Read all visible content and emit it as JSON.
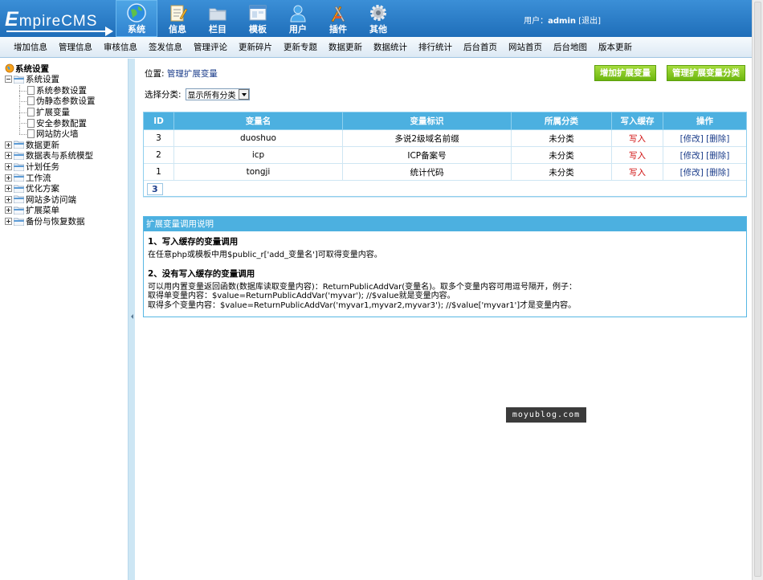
{
  "logo": {
    "first": "E",
    "rest": "mpireCMS"
  },
  "topnav": [
    {
      "label": "系统",
      "icon": "globe-icon",
      "active": true
    },
    {
      "label": "信息",
      "icon": "notepad-icon"
    },
    {
      "label": "栏目",
      "icon": "folder-icon"
    },
    {
      "label": "模板",
      "icon": "window-icon"
    },
    {
      "label": "用户",
      "icon": "user-icon"
    },
    {
      "label": "插件",
      "icon": "tools-icon"
    },
    {
      "label": "其他",
      "icon": "gear-icon"
    }
  ],
  "user": {
    "prefix": "用户：",
    "name": "admin",
    "logout": "[退出]"
  },
  "subnav": [
    "增加信息",
    "管理信息",
    "审核信息",
    "签发信息",
    "管理评论",
    "更新碎片",
    "更新专题",
    "数据更新",
    "数据统计",
    "排行统计",
    "后台首页",
    "网站首页",
    "后台地图",
    "版本更新"
  ],
  "tree": {
    "root": "系统设置",
    "open_folder": "系统设置",
    "children": [
      "系统参数设置",
      "伪静态参数设置",
      "扩展变量",
      "安全参数配置",
      "网站防火墙"
    ],
    "folders": [
      "数据更新",
      "数据表与系统模型",
      "计划任务",
      "工作流",
      "优化方案",
      "网站多访问端",
      "扩展菜单",
      "备份与恢复数据"
    ]
  },
  "breadcrumb": {
    "prefix": "位置: ",
    "link": "管理扩展变量"
  },
  "buttons": {
    "add": "增加扩展变量",
    "manage_class": "管理扩展变量分类"
  },
  "filter": {
    "label": "选择分类:",
    "selected": "显示所有分类"
  },
  "table": {
    "headers": [
      "ID",
      "变量名",
      "变量标识",
      "所属分类",
      "写入缓存",
      "操作"
    ],
    "rows": [
      {
        "id": "3",
        "name": "duoshuo",
        "tag": "多说2级域名前缀",
        "category": "未分类",
        "cache": "写入",
        "edit": "[修改]",
        "del": "[删除]"
      },
      {
        "id": "2",
        "name": "icp",
        "tag": "ICP备案号",
        "category": "未分类",
        "cache": "写入",
        "edit": "[修改]",
        "del": "[删除]"
      },
      {
        "id": "1",
        "name": "tongji",
        "tag": "统计代码",
        "category": "未分类",
        "cache": "写入",
        "edit": "[修改]",
        "del": "[删除]"
      }
    ],
    "pager": "3"
  },
  "help": {
    "title": "扩展变量调用说明",
    "h1": "1、写入缓存的变量调用",
    "p1": "在任意php或模板中用$public_r['add_变量名']可取得变量内容。",
    "h2": "2、没有写入缓存的变量调用",
    "p2": "可以用内置变量返回函数(数据库读取变量内容)：ReturnPublicAddVar(变量名)。取多个变量内容可用逗号隔开，例子：",
    "p3": "取得单变量内容：$value=ReturnPublicAddVar('myvar'); //$value就是变量内容。",
    "p4": "取得多个变量内容：$value=ReturnPublicAddVar('myvar1,myvar2,myvar3'); //$value['myvar1']才是变量内容。"
  },
  "watermark": "moyublog.com",
  "colors": {
    "header": "#2a7fc9",
    "table_header": "#4cb0e0",
    "button_green": "#7fc31c",
    "write_red": "#d01010",
    "link_blue": "#1a3c8a"
  }
}
